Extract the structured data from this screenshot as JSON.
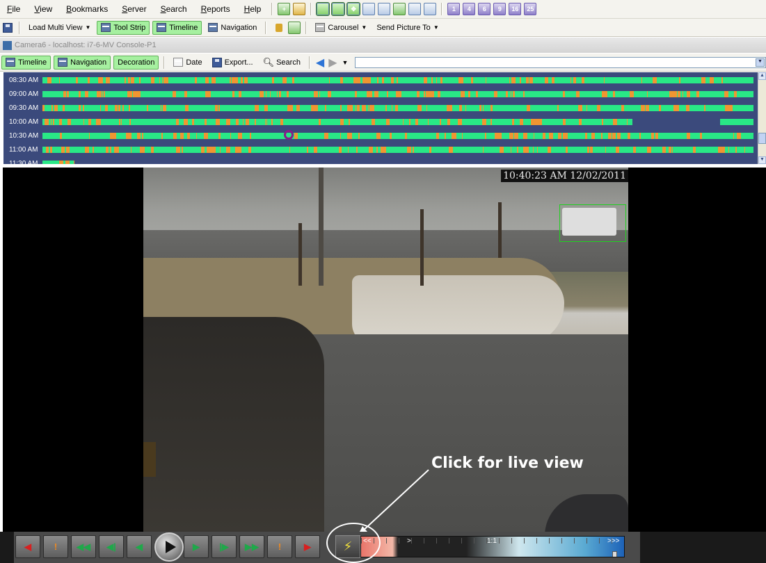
{
  "menu": {
    "items": [
      "File",
      "View",
      "Bookmarks",
      "Server",
      "Search",
      "Reports",
      "Help"
    ],
    "underline": [
      "F",
      "V",
      "B",
      "S",
      "S",
      "R",
      "H"
    ]
  },
  "toolbar1": {
    "load_multi_view": "Load Multi View",
    "tool_strip": "Tool Strip",
    "timeline": "Timeline",
    "navigation": "Navigation",
    "carousel": "Carousel",
    "send_picture_to": "Send Picture To"
  },
  "layout_buttons": [
    "1",
    "4",
    "6",
    "9",
    "16",
    "25"
  ],
  "window": {
    "title": "Camera6 - localhost: i7-6-MV Console-P1"
  },
  "toolbar2": {
    "timeline": "Timeline",
    "navigation": "Navigation",
    "decoration": "Decoration",
    "date": "Date",
    "export": "Export...",
    "search": "Search",
    "combo_value": ""
  },
  "timeline": {
    "rows": [
      {
        "time": "08:30 AM",
        "fill": 1.0
      },
      {
        "time": "09:00 AM",
        "fill": 1.0
      },
      {
        "time": "09:30 AM",
        "fill": 1.0
      },
      {
        "time": "10:00 AM",
        "fill": 0.83,
        "tail_fill_start": 0.953
      },
      {
        "time": "10:30 AM",
        "fill": 1.0
      },
      {
        "time": "11:00 AM",
        "fill": 1.0
      },
      {
        "time": "11:30 AM",
        "fill": 0.045
      }
    ],
    "colors": {
      "motion": "#29e886",
      "event": "#f09631",
      "background": "#3b4a7c"
    }
  },
  "video": {
    "timestamp": "10:40:23 AM 12/02/2011",
    "annotation": "Click for live view"
  },
  "playback": {
    "buttons": [
      "go-to-start",
      "previous-event",
      "fast-rewind",
      "slow-rewind",
      "step-back",
      "play",
      "step-forward",
      "slow-forward",
      "fast-forward",
      "next-event",
      "go-to-end"
    ],
    "speed_labels": {
      "min": "<<",
      "mid_low": ">",
      "mid": "1:1",
      "max": ">>>"
    },
    "speed_level": 0.97
  }
}
